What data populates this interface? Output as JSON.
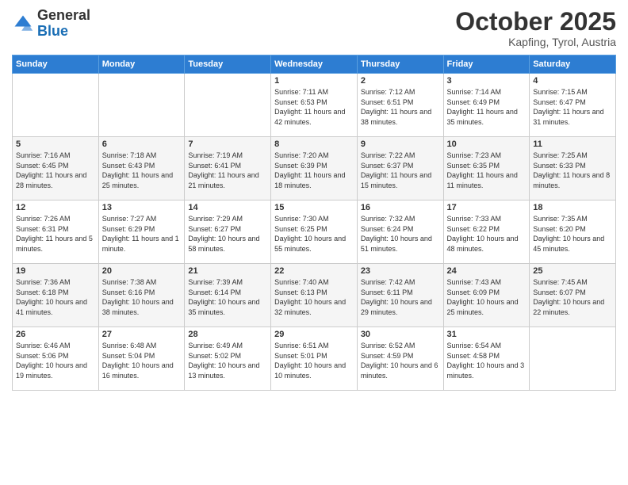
{
  "header": {
    "logo_general": "General",
    "logo_blue": "Blue",
    "month_title": "October 2025",
    "subtitle": "Kapfing, Tyrol, Austria"
  },
  "weekdays": [
    "Sunday",
    "Monday",
    "Tuesday",
    "Wednesday",
    "Thursday",
    "Friday",
    "Saturday"
  ],
  "weeks": [
    [
      {
        "day": "",
        "sunrise": "",
        "sunset": "",
        "daylight": ""
      },
      {
        "day": "",
        "sunrise": "",
        "sunset": "",
        "daylight": ""
      },
      {
        "day": "",
        "sunrise": "",
        "sunset": "",
        "daylight": ""
      },
      {
        "day": "1",
        "sunrise": "Sunrise: 7:11 AM",
        "sunset": "Sunset: 6:53 PM",
        "daylight": "Daylight: 11 hours and 42 minutes."
      },
      {
        "day": "2",
        "sunrise": "Sunrise: 7:12 AM",
        "sunset": "Sunset: 6:51 PM",
        "daylight": "Daylight: 11 hours and 38 minutes."
      },
      {
        "day": "3",
        "sunrise": "Sunrise: 7:14 AM",
        "sunset": "Sunset: 6:49 PM",
        "daylight": "Daylight: 11 hours and 35 minutes."
      },
      {
        "day": "4",
        "sunrise": "Sunrise: 7:15 AM",
        "sunset": "Sunset: 6:47 PM",
        "daylight": "Daylight: 11 hours and 31 minutes."
      }
    ],
    [
      {
        "day": "5",
        "sunrise": "Sunrise: 7:16 AM",
        "sunset": "Sunset: 6:45 PM",
        "daylight": "Daylight: 11 hours and 28 minutes."
      },
      {
        "day": "6",
        "sunrise": "Sunrise: 7:18 AM",
        "sunset": "Sunset: 6:43 PM",
        "daylight": "Daylight: 11 hours and 25 minutes."
      },
      {
        "day": "7",
        "sunrise": "Sunrise: 7:19 AM",
        "sunset": "Sunset: 6:41 PM",
        "daylight": "Daylight: 11 hours and 21 minutes."
      },
      {
        "day": "8",
        "sunrise": "Sunrise: 7:20 AM",
        "sunset": "Sunset: 6:39 PM",
        "daylight": "Daylight: 11 hours and 18 minutes."
      },
      {
        "day": "9",
        "sunrise": "Sunrise: 7:22 AM",
        "sunset": "Sunset: 6:37 PM",
        "daylight": "Daylight: 11 hours and 15 minutes."
      },
      {
        "day": "10",
        "sunrise": "Sunrise: 7:23 AM",
        "sunset": "Sunset: 6:35 PM",
        "daylight": "Daylight: 11 hours and 11 minutes."
      },
      {
        "day": "11",
        "sunrise": "Sunrise: 7:25 AM",
        "sunset": "Sunset: 6:33 PM",
        "daylight": "Daylight: 11 hours and 8 minutes."
      }
    ],
    [
      {
        "day": "12",
        "sunrise": "Sunrise: 7:26 AM",
        "sunset": "Sunset: 6:31 PM",
        "daylight": "Daylight: 11 hours and 5 minutes."
      },
      {
        "day": "13",
        "sunrise": "Sunrise: 7:27 AM",
        "sunset": "Sunset: 6:29 PM",
        "daylight": "Daylight: 11 hours and 1 minute."
      },
      {
        "day": "14",
        "sunrise": "Sunrise: 7:29 AM",
        "sunset": "Sunset: 6:27 PM",
        "daylight": "Daylight: 10 hours and 58 minutes."
      },
      {
        "day": "15",
        "sunrise": "Sunrise: 7:30 AM",
        "sunset": "Sunset: 6:25 PM",
        "daylight": "Daylight: 10 hours and 55 minutes."
      },
      {
        "day": "16",
        "sunrise": "Sunrise: 7:32 AM",
        "sunset": "Sunset: 6:24 PM",
        "daylight": "Daylight: 10 hours and 51 minutes."
      },
      {
        "day": "17",
        "sunrise": "Sunrise: 7:33 AM",
        "sunset": "Sunset: 6:22 PM",
        "daylight": "Daylight: 10 hours and 48 minutes."
      },
      {
        "day": "18",
        "sunrise": "Sunrise: 7:35 AM",
        "sunset": "Sunset: 6:20 PM",
        "daylight": "Daylight: 10 hours and 45 minutes."
      }
    ],
    [
      {
        "day": "19",
        "sunrise": "Sunrise: 7:36 AM",
        "sunset": "Sunset: 6:18 PM",
        "daylight": "Daylight: 10 hours and 41 minutes."
      },
      {
        "day": "20",
        "sunrise": "Sunrise: 7:38 AM",
        "sunset": "Sunset: 6:16 PM",
        "daylight": "Daylight: 10 hours and 38 minutes."
      },
      {
        "day": "21",
        "sunrise": "Sunrise: 7:39 AM",
        "sunset": "Sunset: 6:14 PM",
        "daylight": "Daylight: 10 hours and 35 minutes."
      },
      {
        "day": "22",
        "sunrise": "Sunrise: 7:40 AM",
        "sunset": "Sunset: 6:13 PM",
        "daylight": "Daylight: 10 hours and 32 minutes."
      },
      {
        "day": "23",
        "sunrise": "Sunrise: 7:42 AM",
        "sunset": "Sunset: 6:11 PM",
        "daylight": "Daylight: 10 hours and 29 minutes."
      },
      {
        "day": "24",
        "sunrise": "Sunrise: 7:43 AM",
        "sunset": "Sunset: 6:09 PM",
        "daylight": "Daylight: 10 hours and 25 minutes."
      },
      {
        "day": "25",
        "sunrise": "Sunrise: 7:45 AM",
        "sunset": "Sunset: 6:07 PM",
        "daylight": "Daylight: 10 hours and 22 minutes."
      }
    ],
    [
      {
        "day": "26",
        "sunrise": "Sunrise: 6:46 AM",
        "sunset": "Sunset: 5:06 PM",
        "daylight": "Daylight: 10 hours and 19 minutes."
      },
      {
        "day": "27",
        "sunrise": "Sunrise: 6:48 AM",
        "sunset": "Sunset: 5:04 PM",
        "daylight": "Daylight: 10 hours and 16 minutes."
      },
      {
        "day": "28",
        "sunrise": "Sunrise: 6:49 AM",
        "sunset": "Sunset: 5:02 PM",
        "daylight": "Daylight: 10 hours and 13 minutes."
      },
      {
        "day": "29",
        "sunrise": "Sunrise: 6:51 AM",
        "sunset": "Sunset: 5:01 PM",
        "daylight": "Daylight: 10 hours and 10 minutes."
      },
      {
        "day": "30",
        "sunrise": "Sunrise: 6:52 AM",
        "sunset": "Sunset: 4:59 PM",
        "daylight": "Daylight: 10 hours and 6 minutes."
      },
      {
        "day": "31",
        "sunrise": "Sunrise: 6:54 AM",
        "sunset": "Sunset: 4:58 PM",
        "daylight": "Daylight: 10 hours and 3 minutes."
      },
      {
        "day": "",
        "sunrise": "",
        "sunset": "",
        "daylight": ""
      }
    ]
  ]
}
